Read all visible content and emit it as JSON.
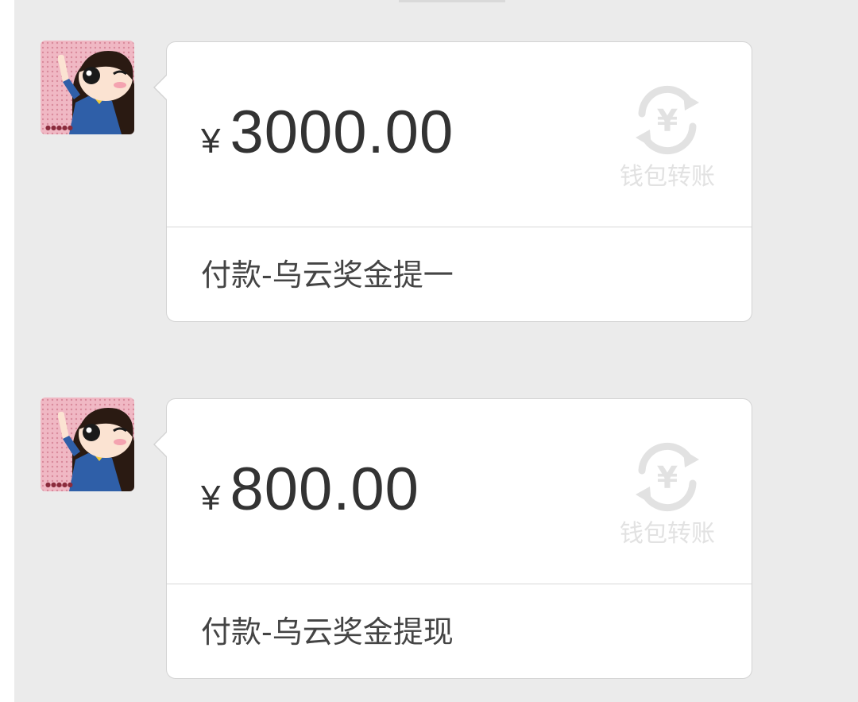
{
  "messages": [
    {
      "amount": "3000.00",
      "currency_symbol": "¥",
      "memo": "付款-乌云奖金提一",
      "transfer_label": "钱包转账",
      "transfer_icon": "yuan-transfer-icon"
    },
    {
      "amount": "800.00",
      "currency_symbol": "¥",
      "memo": "付款-乌云奖金提现",
      "transfer_label": "钱包转账",
      "transfer_icon": "yuan-transfer-icon"
    }
  ],
  "colors": {
    "chat_background": "#ebebeb",
    "bubble_background": "#ffffff",
    "amount_text": "#333333",
    "watermark": "#e2e2e2"
  }
}
